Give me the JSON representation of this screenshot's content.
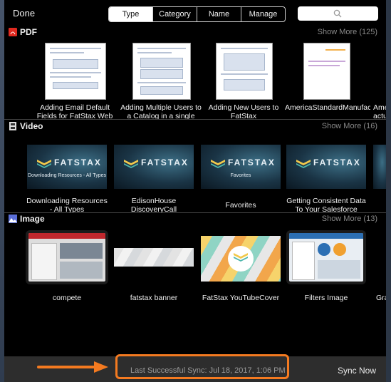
{
  "header": {
    "done_label": "Done",
    "segments": [
      "Type",
      "Category",
      "Name",
      "Manage"
    ],
    "active_segment": "Type",
    "search_icon": "search-icon"
  },
  "pdf": {
    "title": "PDF",
    "show_more": "Show More (125)",
    "items": [
      {
        "caption": "Adding Email Default Fields for FatStax Web"
      },
      {
        "caption": "Adding Multiple Users to a Catalog in a single"
      },
      {
        "caption": "Adding New Users to FatStax"
      },
      {
        "caption": "AmericaStandardManufacturerRepSurveyRepor"
      },
      {
        "caption": "Ame acture"
      }
    ]
  },
  "video": {
    "title": "Video",
    "show_more": "Show More (16)",
    "thumb_brand": "FATSTAX",
    "items": [
      {
        "caption": "Downloading Resources - All Types",
        "overlay": "Downloading Resources - All Types"
      },
      {
        "caption": "EdisonHouse DiscoveryCall",
        "overlay": ""
      },
      {
        "caption": "Favorites",
        "overlay": "Favorites"
      },
      {
        "caption": "Getting Consistent Data To Your Salesforce",
        "overlay": ""
      }
    ]
  },
  "image": {
    "title": "Image",
    "show_more": "Show More (13)",
    "items": [
      {
        "caption": "compete"
      },
      {
        "caption": "fatstax banner"
      },
      {
        "caption": "FatStax YouTubeCover"
      },
      {
        "caption": "Filters Image"
      },
      {
        "caption": "Gra"
      }
    ]
  },
  "footer": {
    "sync_status": "Last Successful Sync: Jul 18, 2017, 1:06 PM",
    "sync_now_label": "Sync Now"
  },
  "colors": {
    "highlight": "#f47a20",
    "pdf_icon": "#e0291f"
  }
}
